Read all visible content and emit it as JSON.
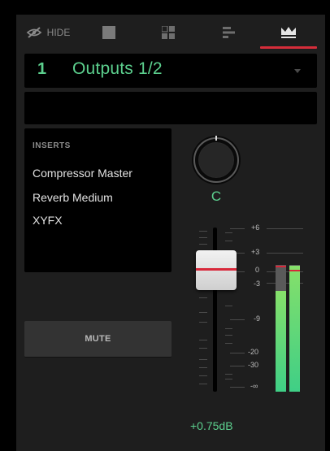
{
  "toolbar": {
    "hide_label": "HIDE",
    "tabs": [
      "single",
      "grid",
      "bars",
      "crown"
    ],
    "active_tab": "crown",
    "accent": "#d62d3a"
  },
  "track": {
    "number": "1",
    "name": "Outputs 1/2",
    "name_color": "#5cd08e"
  },
  "name_field": {
    "value": ""
  },
  "inserts": {
    "title": "INSERTS",
    "items": [
      "Compressor Master",
      "Reverb Medium",
      "XYFX"
    ]
  },
  "pan": {
    "value": "C"
  },
  "mute": {
    "label": "MUTE"
  },
  "fader": {
    "scale": [
      "+6",
      "+3",
      "0",
      "-3",
      "-9",
      "-20",
      "-30",
      "-∞"
    ],
    "volume_label": "+0.75dB"
  },
  "meters": {
    "left_level": 0.52,
    "right_level": 0.65
  }
}
